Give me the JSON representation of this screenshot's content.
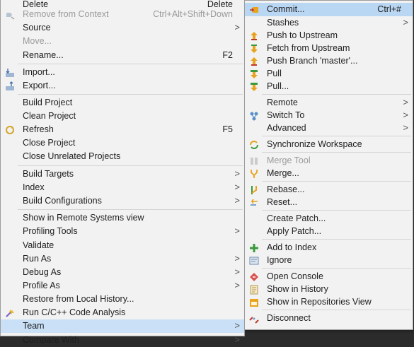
{
  "main_menu": {
    "items": [
      {
        "label": "Delete",
        "accel": "Delete",
        "disabled": false
      },
      {
        "label": "Remove from Context",
        "accel": "Ctrl+Alt+Shift+Down",
        "disabled": true,
        "icon": "remove-context-icon"
      },
      {
        "label": "Source",
        "submenu": true
      },
      {
        "label": "Move...",
        "disabled": true
      },
      {
        "label": "Rename...",
        "accel": "F2"
      },
      {
        "label": "Import...",
        "icon": "import-icon"
      },
      {
        "label": "Export...",
        "icon": "export-icon"
      },
      {
        "label": "Build Project"
      },
      {
        "label": "Clean Project"
      },
      {
        "label": "Refresh",
        "accel": "F5",
        "icon": "refresh-icon"
      },
      {
        "label": "Close Project"
      },
      {
        "label": "Close Unrelated Projects"
      },
      {
        "label": "Build Targets",
        "submenu": true
      },
      {
        "label": "Index",
        "submenu": true
      },
      {
        "label": "Build Configurations",
        "submenu": true
      },
      {
        "label": "Show in Remote Systems view"
      },
      {
        "label": "Profiling Tools",
        "submenu": true
      },
      {
        "label": "Validate"
      },
      {
        "label": "Run As",
        "submenu": true
      },
      {
        "label": "Debug As",
        "submenu": true
      },
      {
        "label": "Profile As",
        "submenu": true
      },
      {
        "label": "Restore from Local History..."
      },
      {
        "label": "Run C/C++ Code Analysis",
        "icon": "code-analysis-icon"
      },
      {
        "label": "Team",
        "submenu": true,
        "selected": true
      },
      {
        "label": "Compare With",
        "submenu": true
      }
    ]
  },
  "team_menu": {
    "items": [
      {
        "label": "Commit...",
        "accel": "Ctrl+#",
        "icon": "commit-icon",
        "highlighted": true
      },
      {
        "label": "Stashes",
        "submenu": true
      },
      {
        "label": "Push to Upstream",
        "icon": "push-upstream-icon"
      },
      {
        "label": "Fetch from Upstream",
        "icon": "fetch-upstream-icon"
      },
      {
        "label": "Push Branch 'master'...",
        "icon": "push-branch-icon"
      },
      {
        "label": "Pull",
        "icon": "pull-icon"
      },
      {
        "label": "Pull...",
        "icon": "pull-dialog-icon"
      },
      {
        "label": "Remote",
        "submenu": true
      },
      {
        "label": "Switch To",
        "submenu": true,
        "icon": "switch-to-icon"
      },
      {
        "label": "Advanced",
        "submenu": true
      },
      {
        "label": "Synchronize Workspace",
        "icon": "synchronize-icon"
      },
      {
        "label": "Merge Tool",
        "disabled": true,
        "icon": "merge-tool-icon"
      },
      {
        "label": "Merge...",
        "icon": "merge-icon"
      },
      {
        "label": "Rebase...",
        "icon": "rebase-icon"
      },
      {
        "label": "Reset...",
        "icon": "reset-icon"
      },
      {
        "label": "Create Patch..."
      },
      {
        "label": "Apply Patch..."
      },
      {
        "label": "Add to Index",
        "icon": "add-index-icon"
      },
      {
        "label": "Ignore",
        "icon": "ignore-icon"
      },
      {
        "label": "Open Console",
        "icon": "console-icon"
      },
      {
        "label": "Show in History",
        "icon": "history-icon"
      },
      {
        "label": "Show in Repositories View",
        "icon": "repositories-icon"
      },
      {
        "label": "Disconnect",
        "icon": "disconnect-icon"
      }
    ]
  },
  "submenu_arrow": ">",
  "colors": {
    "menu_bg": "#f2f2f2",
    "selection": "#c9e0f7",
    "disabled_text": "#9a9a9a",
    "git_orange": "#e8a21c",
    "git_green": "#3a9a3a"
  }
}
